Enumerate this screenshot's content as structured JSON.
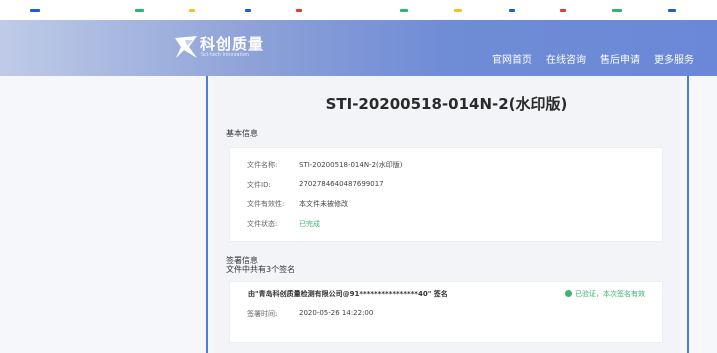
{
  "top_bar": {
    "dash_colors": [
      "#1e5bd6",
      "#2bb673",
      "#f0c419",
      "#1e5bd6",
      "#e53935",
      "#2bb673",
      "#f0c419",
      "#1e5bd6",
      "#e53935",
      "#2bb673",
      "#1e5bd6"
    ]
  },
  "header": {
    "logo_title": "科创质量",
    "logo_sub": "Sci-tech innovation",
    "nav": [
      "官网首页",
      "在线咨询",
      "售后申请",
      "更多服务"
    ]
  },
  "document": {
    "title": "STI-20200518-014N-2(水印版)",
    "basic_info_label": "基本信息",
    "fields": [
      {
        "key": "文件名称:",
        "value": "STI-20200518-014N-2(水印版)"
      },
      {
        "key": "文件ID:",
        "value": "2702784640487699017"
      },
      {
        "key": "文件有效性:",
        "value": "本文件未被修改"
      },
      {
        "key": "文件状态:",
        "value": "已完成"
      }
    ],
    "signature_label": "签署信息",
    "signature_count_text": "文件中共有3个签名",
    "signature": {
      "by": "由\"青岛科创质量检测有限公司@91****************40\" 签名",
      "status": "已验证，本次签名有效",
      "time_key": "签署时间:",
      "time_value": "2020-05-26 14:22:00"
    }
  },
  "colors": {
    "accent_blue": "#4f7dd1",
    "status_green": "#3cb371"
  }
}
